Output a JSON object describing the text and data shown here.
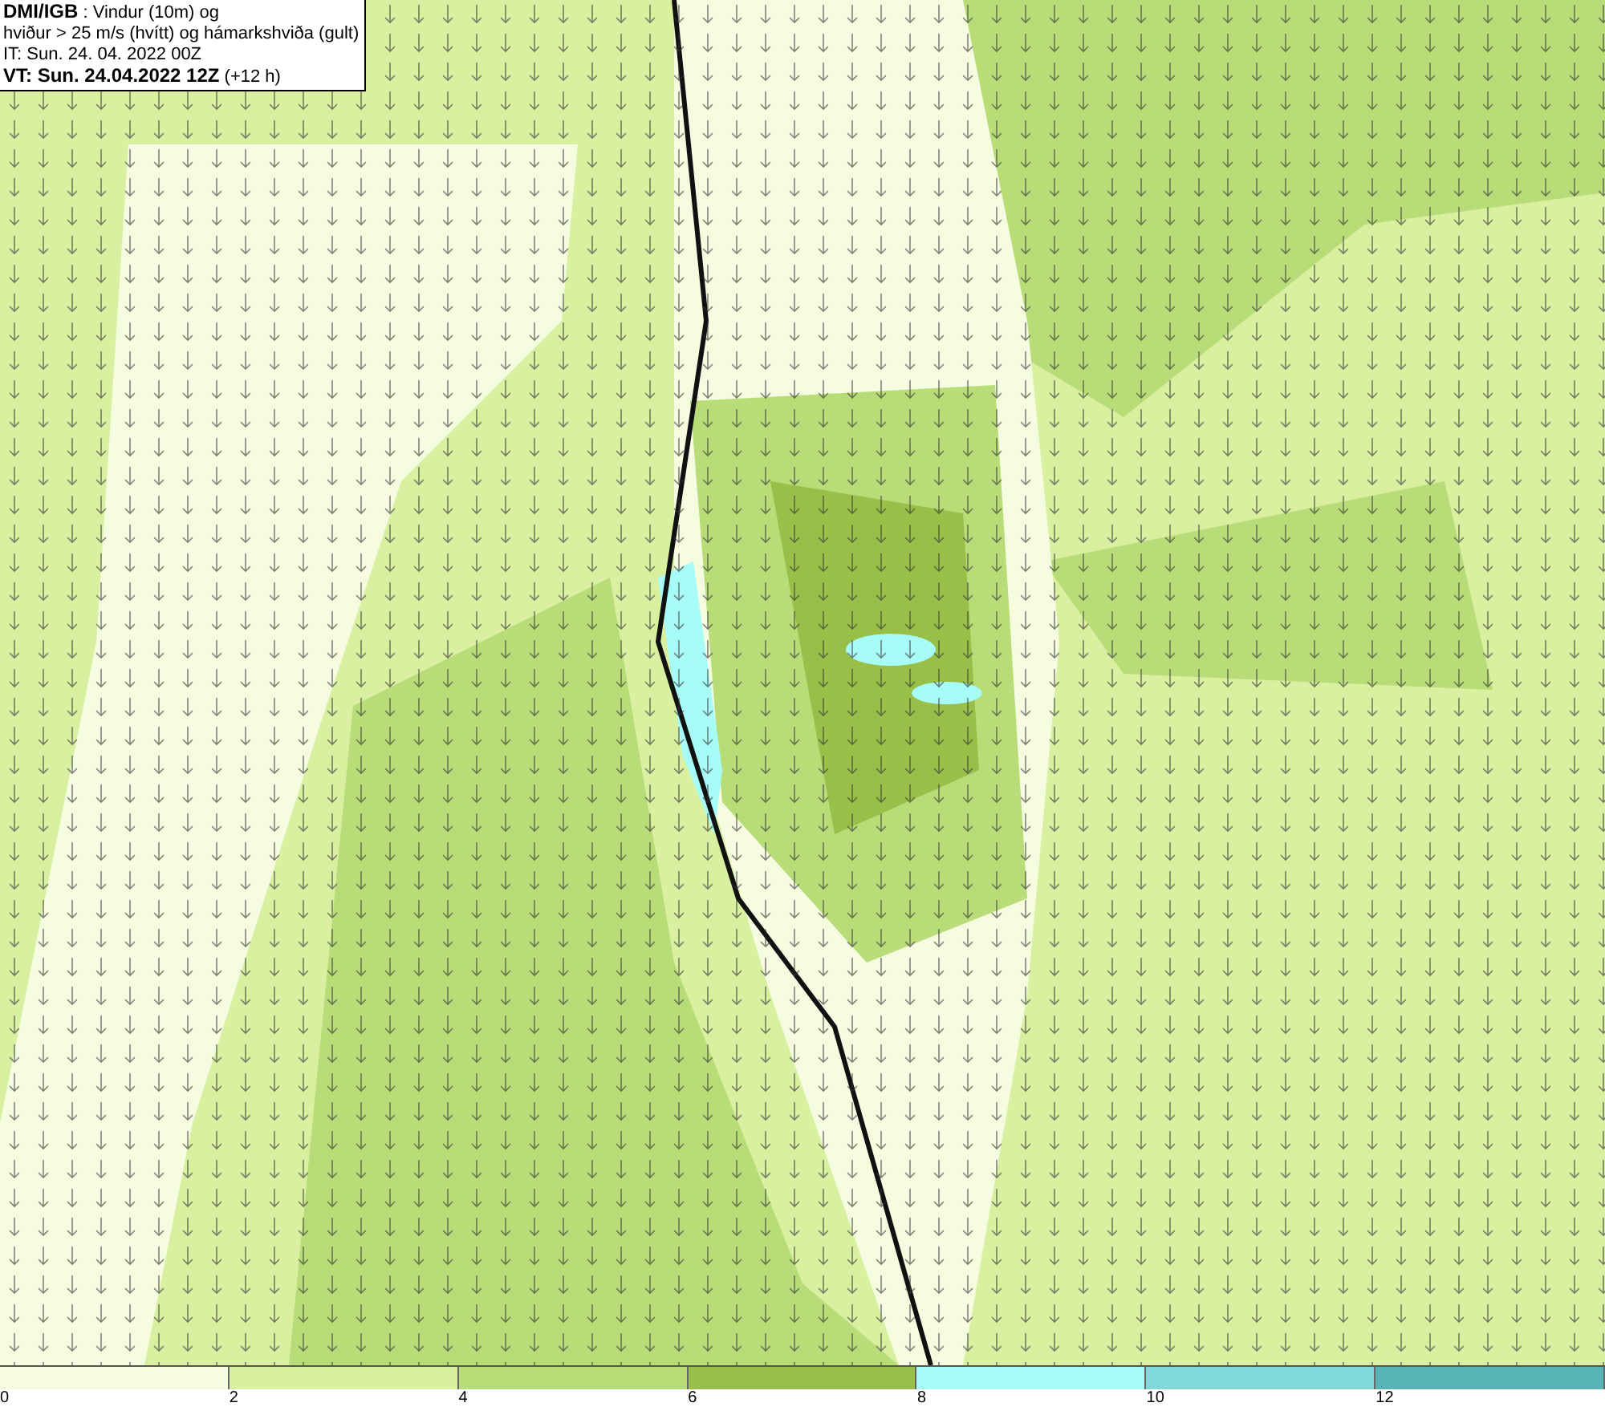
{
  "info_box": {
    "lines": [
      "**DMI/IGB** : Vindur (10m) og",
      "hviður > 25 m/s (hvítt) og hámarkshviða (gult)",
      "IT: Sun. 24. 04. 2022 00Z",
      "**VT: Sun. 24.04.2022 12Z** (+12 h)"
    ]
  },
  "legend": [
    {
      "label": "0",
      "color": "#f5fce0"
    },
    {
      "label": "2",
      "color": "#d8f0a0"
    },
    {
      "label": "4",
      "color": "#b8dc78"
    },
    {
      "label": "6",
      "color": "#98c048"
    },
    {
      "label": "8",
      "color": "#a8fcf8"
    },
    {
      "label": "10",
      "color": "#80d8d8"
    },
    {
      "label": "12",
      "color": "#58b4b4"
    }
  ]
}
